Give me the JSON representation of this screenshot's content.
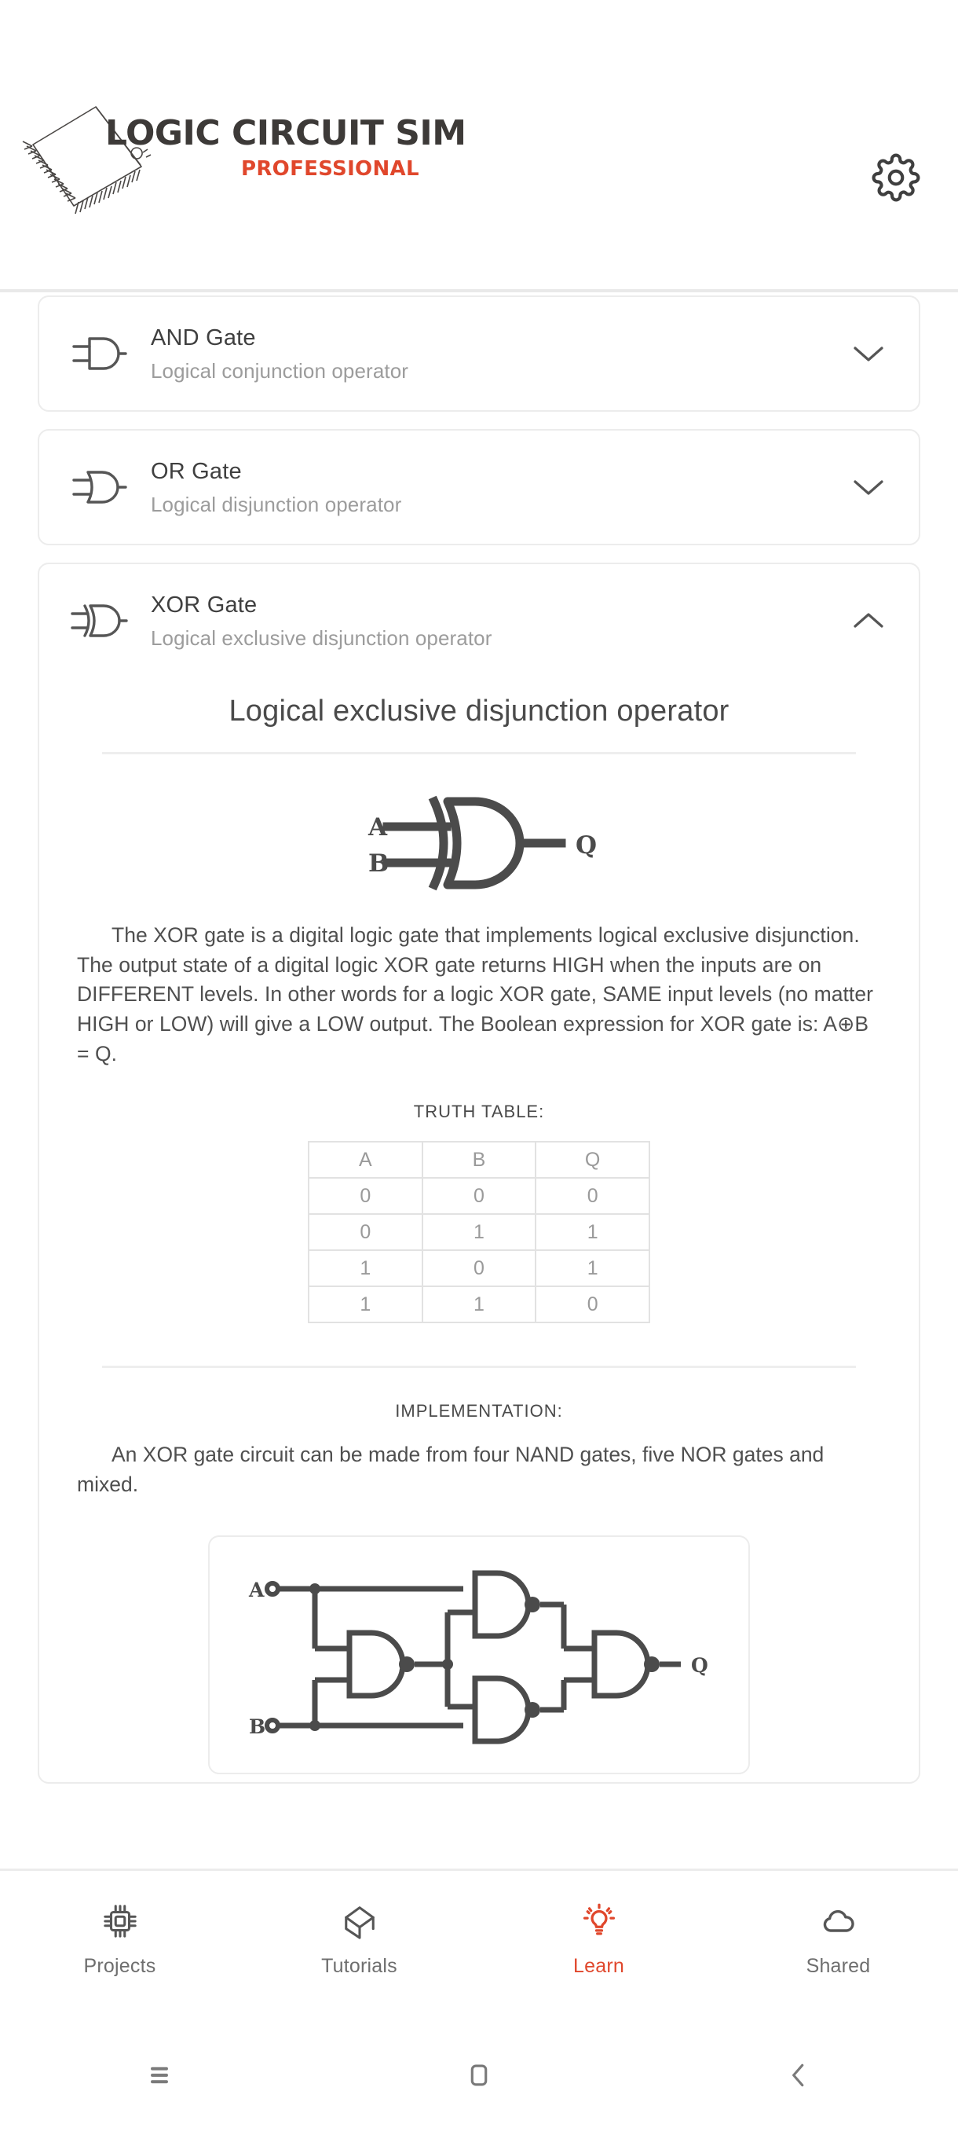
{
  "app": {
    "logo_title": "LOGIC CIRCUIT SIM",
    "logo_subtitle": "PROFESSIONAL",
    "brand_dark": "#3d3a38",
    "brand_red": "#e0472c",
    "settings_icon": "gear-icon"
  },
  "gates": [
    {
      "id": "and",
      "title": "AND Gate",
      "subtitle": "Logical conjunction operator",
      "icon": "and-gate-icon",
      "expanded": false,
      "chevron": "chevron-down-icon"
    },
    {
      "id": "or",
      "title": "OR Gate",
      "subtitle": "Logical disjunction operator",
      "icon": "or-gate-icon",
      "expanded": false,
      "chevron": "chevron-down-icon"
    },
    {
      "id": "xor",
      "title": "XOR Gate",
      "subtitle": "Logical exclusive disjunction operator",
      "icon": "xor-gate-icon",
      "expanded": true,
      "chevron": "chevron-up-icon"
    }
  ],
  "xor_detail": {
    "heading": "Logical exclusive disjunction operator",
    "symbol": {
      "input_a": "A",
      "input_b": "B",
      "output": "Q"
    },
    "description": "The XOR gate is a digital logic gate that implements logical exclusive disjunction. The output state of a digital logic XOR gate returns HIGH when the inputs are on DIFFERENT levels. In other words for a logic XOR gate, SAME input levels (no matter HIGH or LOW) will give a LOW output. The Boolean expression for XOR gate is: A⊕B = Q.",
    "truth_table_label": "TRUTH TABLE:",
    "truth_table": {
      "headers": [
        "A",
        "B",
        "Q"
      ],
      "rows": [
        [
          "0",
          "0",
          "0"
        ],
        [
          "0",
          "1",
          "1"
        ],
        [
          "1",
          "0",
          "1"
        ],
        [
          "1",
          "1",
          "0"
        ]
      ]
    },
    "implementation_label": "IMPLEMENTATION:",
    "implementation_text": "An XOR gate circuit can be made from four NAND gates, five NOR gates and mixed.",
    "circuit": {
      "input_a": "A",
      "input_b": "B",
      "output": "Q"
    }
  },
  "bottom_nav": [
    {
      "label": "Projects",
      "icon": "chip-icon",
      "active": false
    },
    {
      "label": "Tutorials",
      "icon": "graduation-cap-icon",
      "active": false
    },
    {
      "label": "Learn",
      "icon": "lightbulb-icon",
      "active": true
    },
    {
      "label": "Shared",
      "icon": "cloud-icon",
      "active": false
    }
  ],
  "system_nav": [
    {
      "name": "recent-apps",
      "icon": "menu-icon"
    },
    {
      "name": "home",
      "icon": "home-square-icon"
    },
    {
      "name": "back",
      "icon": "chevron-left-icon"
    }
  ]
}
